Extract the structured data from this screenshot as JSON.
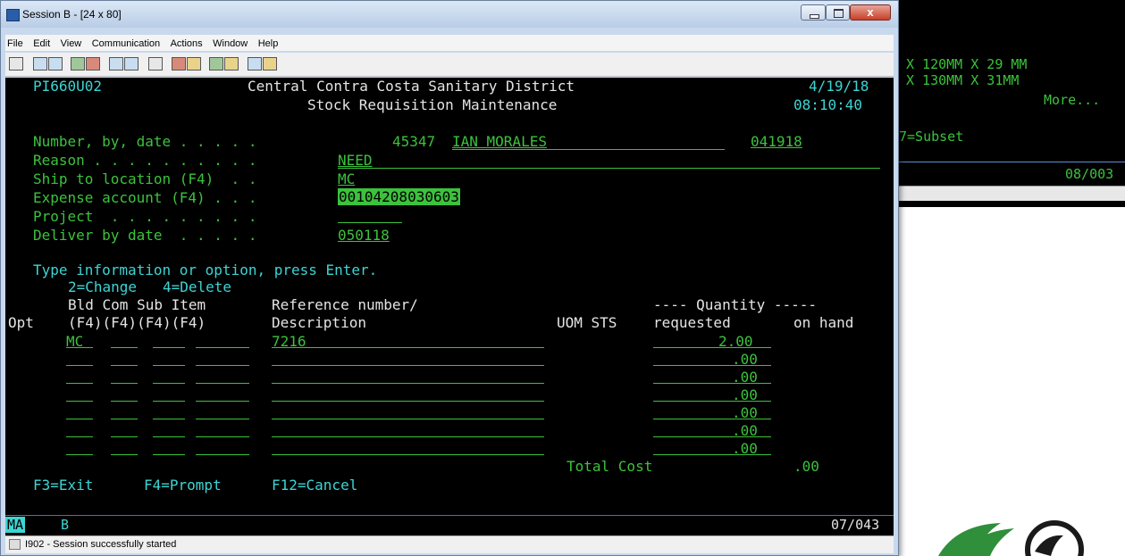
{
  "background_window": {
    "lines": [
      "X 120MM X 29 MM",
      "X 130MM X 31MM",
      "More...",
      "7=Subset",
      "08/003"
    ]
  },
  "window": {
    "title": "Session B - [24 x 80]",
    "minimize_label": "",
    "maximize_label": "",
    "close_label": "x"
  },
  "menu": [
    "File",
    "Edit",
    "View",
    "Communication",
    "Actions",
    "Window",
    "Help"
  ],
  "toolbar_icons": [
    "print-icon",
    "copy-icon",
    "paste-icon",
    "send-icon",
    "receive-icon",
    "display-icon",
    "display2-icon",
    "macro-icon",
    "record-icon",
    "play-icon",
    "keyboard-icon",
    "map-icon",
    "globe-icon",
    "edit-icon"
  ],
  "screen": {
    "program_id": "PI660U02",
    "company": "Central Contra Costa Sanitary District",
    "date": "4/19/18",
    "title": "Stock Requisition Maintenance",
    "time": "08:10:40",
    "labels": {
      "number": "Number, by, date . . . . .",
      "reason": "Reason . . . . . . . . . .",
      "ship": "Ship to location (F4)  . .",
      "expense": "Expense account (F4) . . .",
      "project": "Project  . . . . . . . . .",
      "deliver": "Deliver by date  . . . . ."
    },
    "values": {
      "number": "45347",
      "by": "IAN MORALES",
      "date": "041918",
      "reason": "NEED",
      "ship": "MC",
      "expense": "00104208030603",
      "project": "",
      "deliver": "050118"
    },
    "instructions": "Type information or option, press Enter.",
    "options": "2=Change   4=Delete",
    "col_head1": {
      "bld_com_sub_item": "Bld Com Sub Item",
      "reference": "Reference number/",
      "quantity": "---- Quantity -----"
    },
    "col_head2": {
      "opt": "Opt",
      "f4s": "(F4)(F4)(F4)(F4)",
      "description": "Description",
      "uom_sts": "UOM STS",
      "requested": "requested",
      "on_hand": "on hand"
    },
    "rows": [
      {
        "bld": "MC",
        "ref": "7216",
        "qty": "2.00"
      },
      {
        "bld": "",
        "ref": "",
        "qty": ".00"
      },
      {
        "bld": "",
        "ref": "",
        "qty": ".00"
      },
      {
        "bld": "",
        "ref": "",
        "qty": ".00"
      },
      {
        "bld": "",
        "ref": "",
        "qty": ".00"
      },
      {
        "bld": "",
        "ref": "",
        "qty": ".00"
      },
      {
        "bld": "",
        "ref": "",
        "qty": ".00"
      }
    ],
    "total_label": "Total Cost",
    "total_value": ".00",
    "function_keys": [
      "F3=Exit",
      "F4=Prompt",
      "F12=Cancel"
    ]
  },
  "oia": {
    "mode": "MA",
    "session": "B",
    "cursor": "07/043"
  },
  "status": {
    "message": "I902 - Session successfully started"
  }
}
